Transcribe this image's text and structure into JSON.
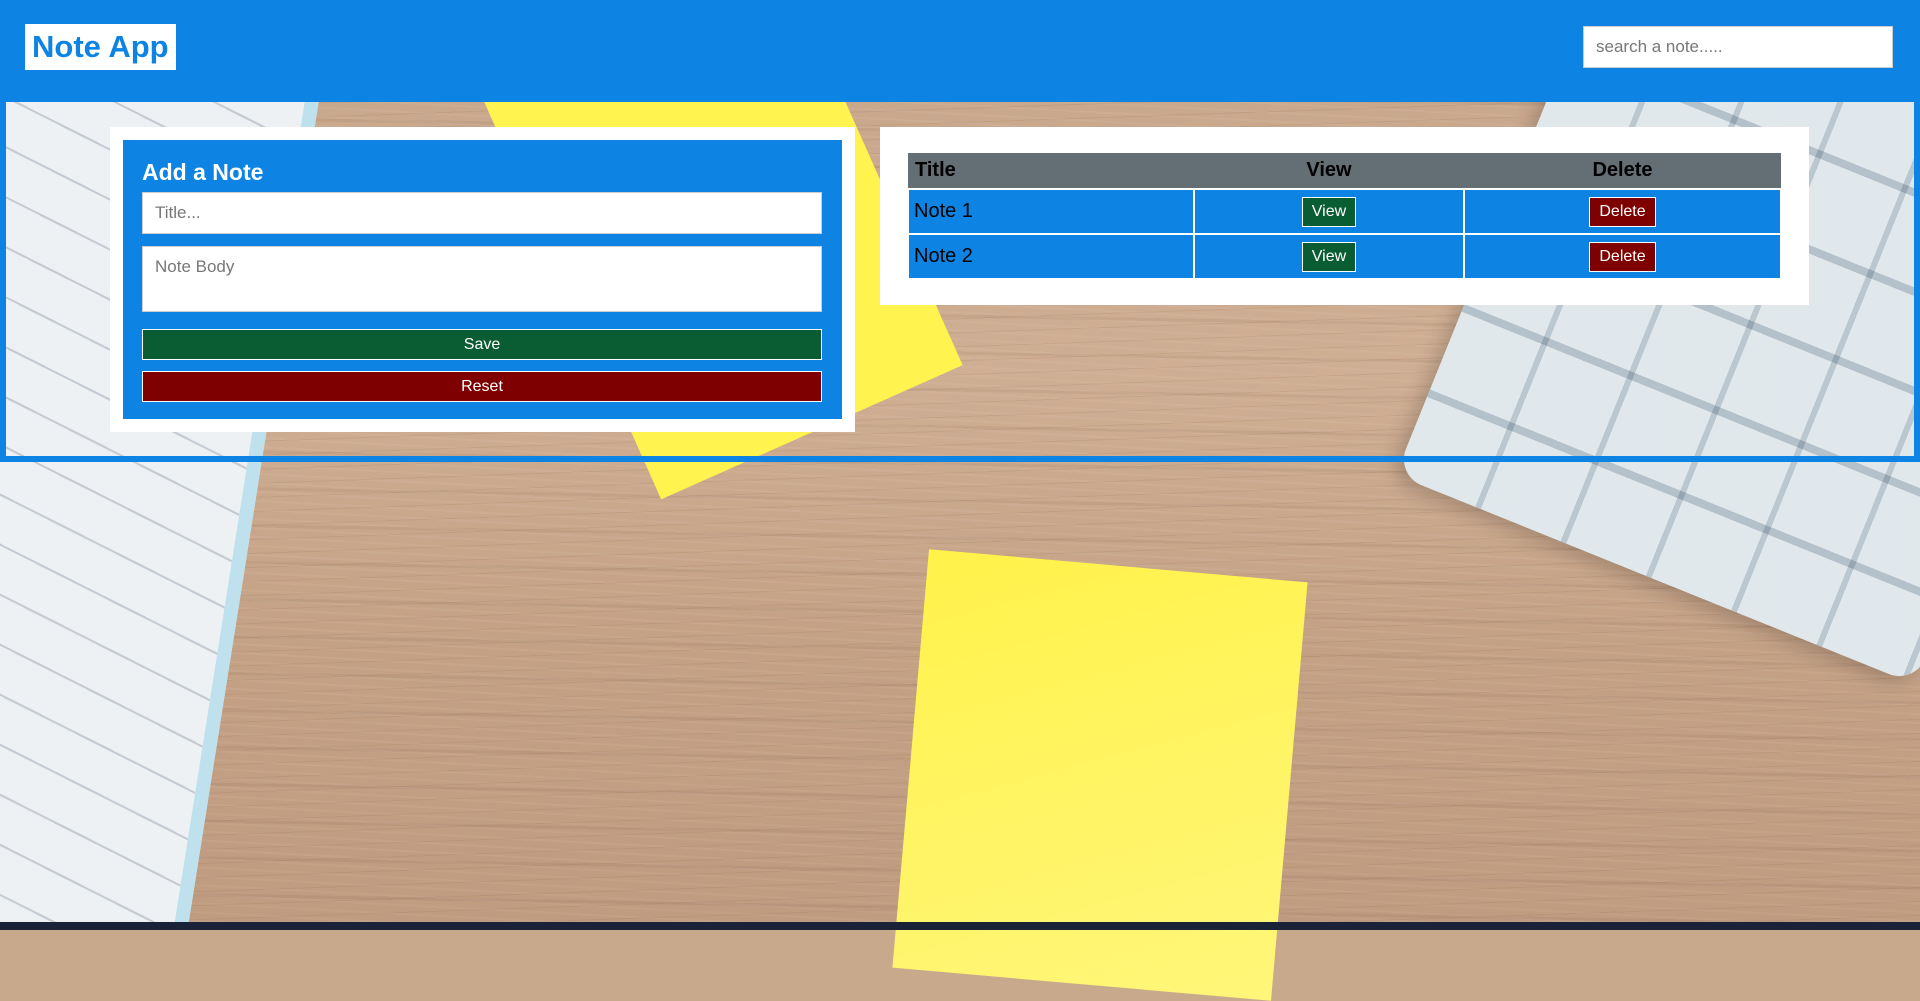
{
  "app": {
    "brand": "Note App"
  },
  "search": {
    "placeholder": "search a note....."
  },
  "form": {
    "heading": "Add a Note",
    "title_placeholder": "Title...",
    "body_placeholder": "Note Body",
    "save_label": "Save",
    "reset_label": "Reset"
  },
  "table": {
    "headers": [
      "Title",
      "View",
      "Delete"
    ],
    "rows": [
      {
        "title": "Note 1",
        "view_label": "View",
        "delete_label": "Delete"
      },
      {
        "title": "Note 2",
        "view_label": "View",
        "delete_label": "Delete"
      }
    ]
  },
  "colors": {
    "primary": "#0d84e3",
    "save": "#0a5d33",
    "delete": "#7f0000",
    "table_header": "#646f75"
  }
}
